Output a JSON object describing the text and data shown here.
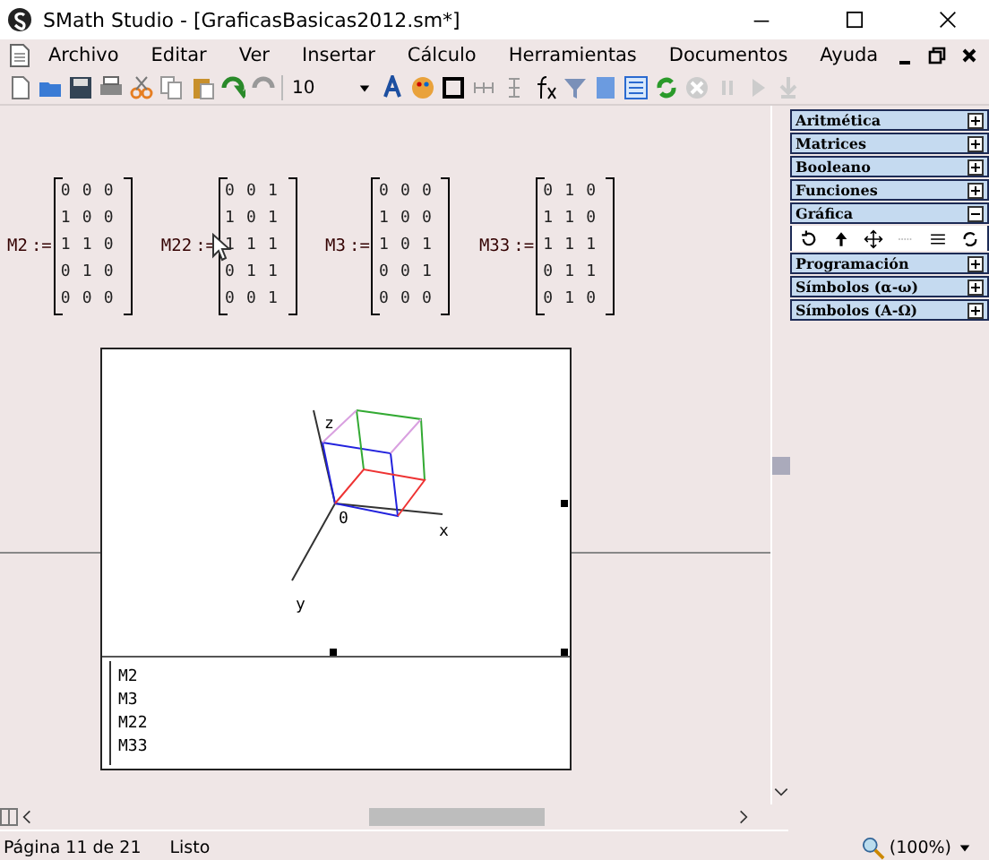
{
  "window": {
    "title": "SMath Studio - [GraficasBasicas2012.sm*]"
  },
  "menu": [
    "Archivo",
    "Editar",
    "Ver",
    "Insertar",
    "Cálculo",
    "Herramientas",
    "Documentos",
    "Ayuda"
  ],
  "toolbar": {
    "font_size": "10"
  },
  "matrices": [
    {
      "name": "M2",
      "operator": ":=",
      "rows": [
        [
          "0",
          "0",
          "0"
        ],
        [
          "1",
          "0",
          "0"
        ],
        [
          "1",
          "1",
          "0"
        ],
        [
          "0",
          "1",
          "0"
        ],
        [
          "0",
          "0",
          "0"
        ]
      ]
    },
    {
      "name": "M22",
      "operator": ":=",
      "rows": [
        [
          "0",
          "0",
          "1"
        ],
        [
          "1",
          "0",
          "1"
        ],
        [
          "1",
          "1",
          "1"
        ],
        [
          "0",
          "1",
          "1"
        ],
        [
          "0",
          "0",
          "1"
        ]
      ]
    },
    {
      "name": "M3",
      "operator": ":=",
      "rows": [
        [
          "0",
          "0",
          "0"
        ],
        [
          "1",
          "0",
          "0"
        ],
        [
          "1",
          "0",
          "1"
        ],
        [
          "0",
          "0",
          "1"
        ],
        [
          "0",
          "0",
          "0"
        ]
      ]
    },
    {
      "name": "M33",
      "operator": ":=",
      "rows": [
        [
          "0",
          "1",
          "0"
        ],
        [
          "1",
          "1",
          "0"
        ],
        [
          "1",
          "1",
          "1"
        ],
        [
          "0",
          "1",
          "1"
        ],
        [
          "0",
          "1",
          "0"
        ]
      ]
    }
  ],
  "plot": {
    "axis_labels": {
      "x": "x",
      "y": "y",
      "z": "z",
      "origin": "0"
    },
    "legend": [
      "M2",
      "M3",
      "M22",
      "M33"
    ]
  },
  "panel": [
    {
      "title": "Aritmética",
      "expanded": false
    },
    {
      "title": "Matrices",
      "expanded": false
    },
    {
      "title": "Booleano",
      "expanded": false
    },
    {
      "title": "Funciones",
      "expanded": false
    },
    {
      "title": "Gráfica",
      "expanded": true
    },
    {
      "title": "Programación",
      "expanded": false
    },
    {
      "title": "Símbolos (α-ω)",
      "expanded": false
    },
    {
      "title": "Símbolos (Α-Ω)",
      "expanded": false
    }
  ],
  "status_bar": {
    "page": "Página 11 de 21",
    "state": "Listo",
    "zoom": "(100%)"
  }
}
